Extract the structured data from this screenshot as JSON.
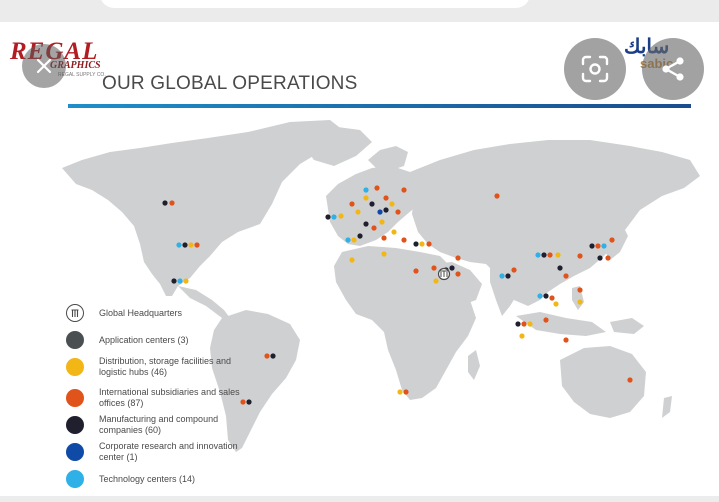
{
  "header": {
    "brand_main": "REGAL",
    "brand_sub": "GRAPHICS",
    "brand_tagline": "REGAL SUPPLY CO.",
    "title": "OUR GLOBAL OPERATIONS",
    "partner_logo_arabic": "سابك",
    "partner_logo_latin": "sabic"
  },
  "overlay_controls": {
    "close_icon": "close-icon",
    "lens_icon": "visual-search-icon",
    "share_icon": "share-icon"
  },
  "legend": [
    {
      "label": "Global Headquarters",
      "color": "#ffffff",
      "icon": "headquarters-icon"
    },
    {
      "label": "Application centers (3)",
      "color": "#4a4f52"
    },
    {
      "label": "Distribution, storage facilities and logistic hubs (46)",
      "color": "#f2b717"
    },
    {
      "label": "International subsidiaries and sales offices (87)",
      "color": "#e0531a"
    },
    {
      "label": "Manufacturing and compound companies (60)",
      "color": "#1f1f2e"
    },
    {
      "label": "Corporate research and innovation center (1)",
      "color": "#0f4aa7"
    },
    {
      "label": "Technology centers (14)",
      "color": "#2fb0e6"
    }
  ],
  "colors": {
    "land": "#cfd0d1",
    "accent_blue": "#1a5f9e",
    "text": "#4a4a4a"
  }
}
